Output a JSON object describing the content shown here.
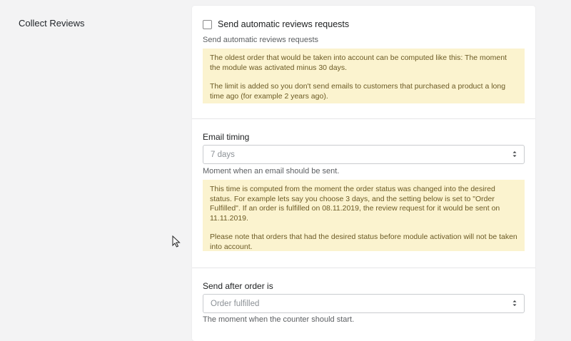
{
  "section": {
    "label": "Collect Reviews"
  },
  "auto_requests": {
    "checkbox_label": "Send automatic reviews requests",
    "checked": false,
    "help": "Send automatic reviews requests",
    "notice_p1": "The oldest order that would be taken into account can be computed like this: The moment the module was activated minus 30 days.",
    "notice_p2": "The limit is added so you don't send emails to customers that purchased a product a long time ago (for example 2 years ago)."
  },
  "email_timing": {
    "label": "Email timing",
    "value": "7 days",
    "help": "Moment when an email should be sent.",
    "notice_p1": "This time is computed from the moment the order status was changed into the desired status. For example lets say you choose 3 days, and the setting below is set to \"Order Fulfilled\". If an order is fulfilled on 08.11.2019, the review request for it would be sent on 11.11.2019.",
    "notice_p2": "Please note that orders that had the desired status before module activation will not be taken into account."
  },
  "send_after": {
    "label": "Send after order is",
    "value": "Order fulfilled",
    "help": "The moment when the counter should start."
  },
  "icons": {
    "select_chevron": "up-down-chevron-icon",
    "mouse_cursor": "mouse-cursor-icon"
  },
  "colors": {
    "notice_background": "#fbf3cf",
    "notice_text": "#6b5a25",
    "page_background": "#f3f3f4",
    "card_background": "#ffffff"
  }
}
